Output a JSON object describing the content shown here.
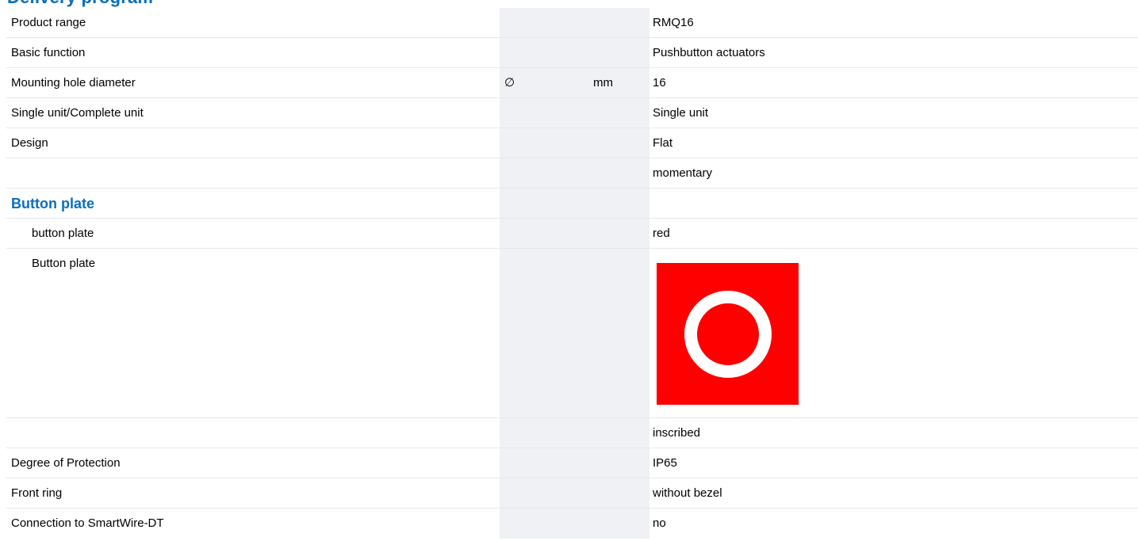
{
  "section_heading_top": "Delivery program",
  "rows": [
    {
      "label": "Product range",
      "symbol": "",
      "unit": "",
      "value": "RMQ16"
    },
    {
      "label": "Basic function",
      "symbol": "",
      "unit": "",
      "value": "Pushbutton actuators"
    },
    {
      "label": "Mounting hole diameter",
      "symbol": "∅",
      "unit": "mm",
      "value": "16"
    },
    {
      "label": "Single unit/Complete unit",
      "symbol": "",
      "unit": "",
      "value": "Single unit"
    },
    {
      "label": "Design",
      "symbol": "",
      "unit": "",
      "value": "Flat"
    },
    {
      "label": "",
      "symbol": "",
      "unit": "",
      "value": "momentary"
    }
  ],
  "button_plate_section": {
    "title": "Button plate",
    "color_row": {
      "label": "button plate",
      "value": "red"
    },
    "image_row": {
      "label": "Button plate",
      "icon": "red-button-plate-ring-icon",
      "plate_color": "#ff0000",
      "ring_color": "#ffffff"
    }
  },
  "rows_after": [
    {
      "label": "",
      "symbol": "",
      "unit": "",
      "value": "inscribed"
    },
    {
      "label": "Degree of Protection",
      "symbol": "",
      "unit": "",
      "value": "IP65"
    },
    {
      "label": "Front ring",
      "symbol": "",
      "unit": "",
      "value": "without bezel"
    },
    {
      "label": "Connection to SmartWire-DT",
      "symbol": "",
      "unit": "",
      "value": "no"
    }
  ]
}
